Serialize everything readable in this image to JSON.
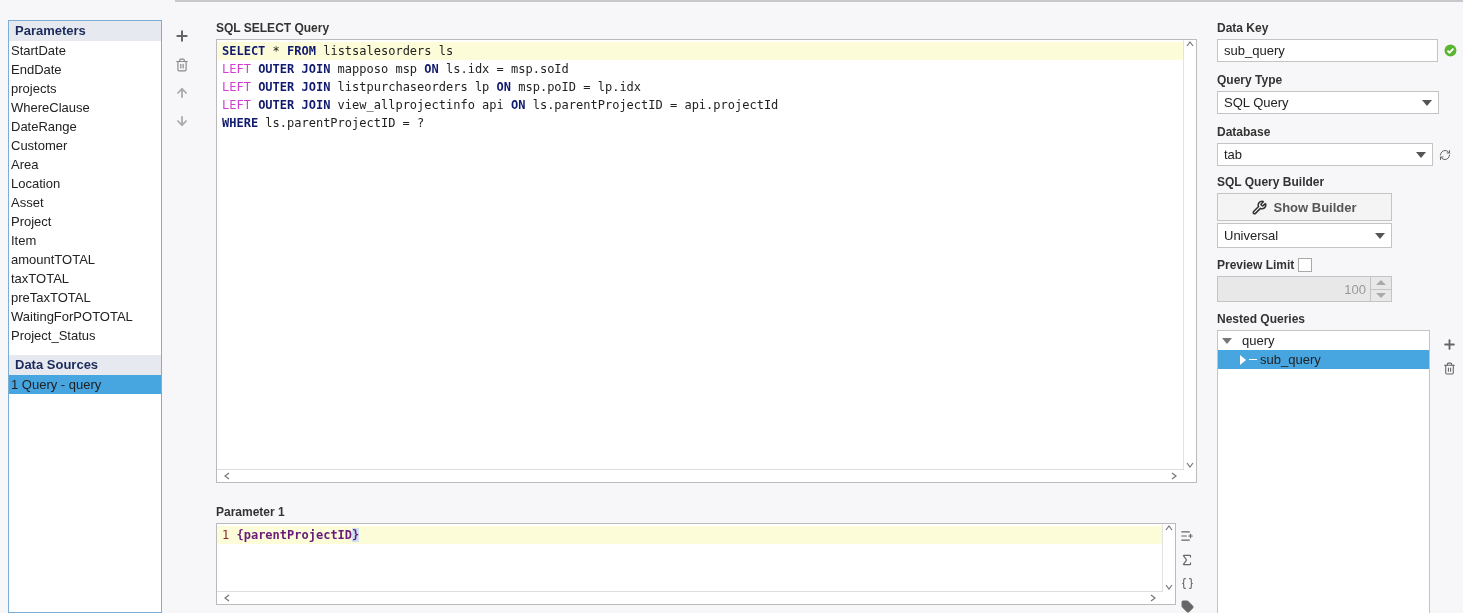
{
  "parameters": {
    "title": "Parameters",
    "items": [
      "StartDate",
      "EndDate",
      "projects",
      "WhereClause",
      "DateRange",
      "Customer",
      "Area",
      "Location",
      "Asset",
      "Project",
      "Item",
      "amountTOTAL",
      "taxTOTAL",
      "preTaxTOTAL",
      "WaitingForPOTOTAL",
      "Project_Status"
    ]
  },
  "data_sources": {
    "title": "Data Sources",
    "items": [
      {
        "label": "1 Query - query",
        "selected": true
      }
    ]
  },
  "sql_query": {
    "label": "SQL SELECT Query",
    "lines": [
      {
        "highlighted": true,
        "tokens": [
          {
            "text": "SELECT",
            "kind": "keyword"
          },
          {
            "text": " * ",
            "kind": "plain"
          },
          {
            "text": "FROM",
            "kind": "keyword"
          },
          {
            "text": " listsalesorders ls",
            "kind": "plain"
          }
        ]
      },
      {
        "highlighted": false,
        "tokens": [
          {
            "text": "LEFT",
            "kind": "modifier"
          },
          {
            "text": " OUTER JOIN",
            "kind": "keyword"
          },
          {
            "text": " mapposo msp ",
            "kind": "plain"
          },
          {
            "text": "ON",
            "kind": "keyword"
          },
          {
            "text": " ls.idx = msp.soId",
            "kind": "plain"
          }
        ]
      },
      {
        "highlighted": false,
        "tokens": [
          {
            "text": "LEFT",
            "kind": "modifier"
          },
          {
            "text": " OUTER JOIN",
            "kind": "keyword"
          },
          {
            "text": " listpurchaseorders lp ",
            "kind": "plain"
          },
          {
            "text": "ON",
            "kind": "keyword"
          },
          {
            "text": " msp.poID = lp.idx",
            "kind": "plain"
          }
        ]
      },
      {
        "highlighted": false,
        "tokens": [
          {
            "text": "LEFT",
            "kind": "modifier"
          },
          {
            "text": " OUTER JOIN",
            "kind": "keyword"
          },
          {
            "text": " view_allprojectinfo api ",
            "kind": "plain"
          },
          {
            "text": "ON",
            "kind": "keyword"
          },
          {
            "text": " ls.parentProjectID = api.projectId",
            "kind": "plain"
          }
        ]
      },
      {
        "highlighted": false,
        "tokens": [
          {
            "text": "WHERE",
            "kind": "keyword"
          },
          {
            "text": " ls.parentProjectID = ?",
            "kind": "plain"
          }
        ]
      }
    ]
  },
  "parameter_editor": {
    "label": "Parameter 1",
    "lines": [
      {
        "number": "1",
        "highlighted": true,
        "tokens": [
          {
            "text": "{parentProjectID",
            "kind": "reference"
          },
          {
            "text": "}",
            "kind": "matched_brace"
          }
        ]
      }
    ]
  },
  "data_key": {
    "label": "Data Key",
    "value": "sub_query",
    "valid": true
  },
  "query_type": {
    "label": "Query Type",
    "value": "SQL Query"
  },
  "database": {
    "label": "Database",
    "value": "tab"
  },
  "query_builder": {
    "label": "SQL Query Builder",
    "button": "Show Builder",
    "dialect": "Universal"
  },
  "preview_limit": {
    "label": "Preview Limit",
    "checked": false,
    "value": "100",
    "disabled": true
  },
  "nested_queries": {
    "label": "Nested Queries",
    "items": [
      {
        "label": "query",
        "expanded": true,
        "selected": false,
        "children": [
          {
            "label": "sub_query",
            "expanded": false,
            "selected": true
          }
        ]
      }
    ]
  }
}
